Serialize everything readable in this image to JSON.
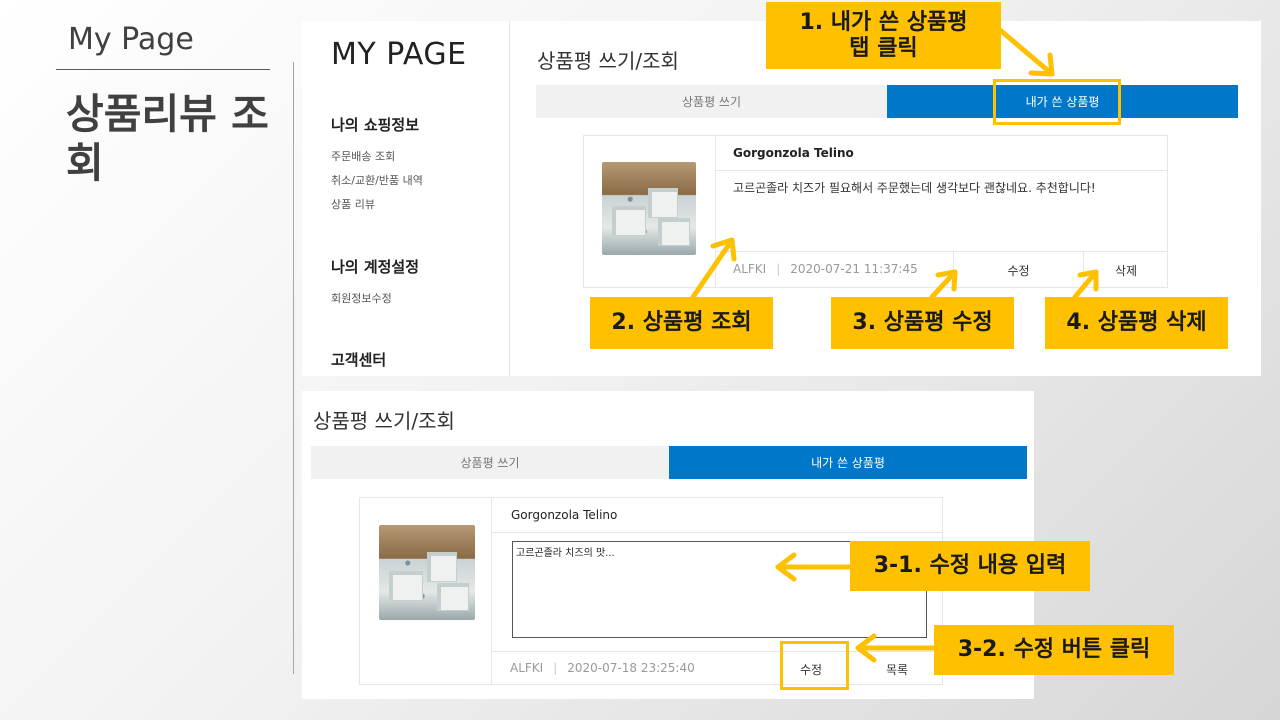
{
  "slide": {
    "subtitle": "My Page",
    "title": "상품리뷰 조회"
  },
  "mypage": {
    "heading": "MY PAGE",
    "shopping_group": "나의 쇼핑정보",
    "shopping_links": [
      "주문배송 조회",
      "취소/교환/반품 내역",
      "상품 리뷰"
    ],
    "account_group": "나의 계정설정",
    "account_links": [
      "회원정보수정"
    ],
    "support_group": "고객센터"
  },
  "review_section": {
    "title": "상품평 쓰기/조회",
    "tab_write": "상품평 쓰기",
    "tab_mine": "내가 쓴 상품평",
    "active_tab": "tab_mine"
  },
  "review_view": {
    "product": "Gorgonzola Telino",
    "text": "고르곤졸라 치즈가 필요해서 주문했는데 생각보다 괜찮네요. 추천합니다!",
    "author": "ALFKI",
    "datetime": "2020-07-21 11:37:45",
    "edit_label": "수정",
    "delete_label": "삭제"
  },
  "review_edit": {
    "product": "Gorgonzola Telino",
    "textarea_value": "고르곤졸라 치즈의 맛...",
    "author": "ALFKI",
    "datetime": "2020-07-18 23:25:40",
    "edit_label": "수정",
    "list_label": "목록"
  },
  "callouts": {
    "step1_line1": "1. 내가 쓴 상품평",
    "step1_line2": "탭 클릭",
    "step2": "2. 상품평 조회",
    "step3": "3. 상품평 수정",
    "step4": "4. 상품평 삭제",
    "step3_1": "3-1. 수정 내용 입력",
    "step3_2": "3-2. 수정 버튼 클릭"
  },
  "colors": {
    "accent_blue": "#0077c8",
    "callout_yellow": "#ffc000"
  }
}
